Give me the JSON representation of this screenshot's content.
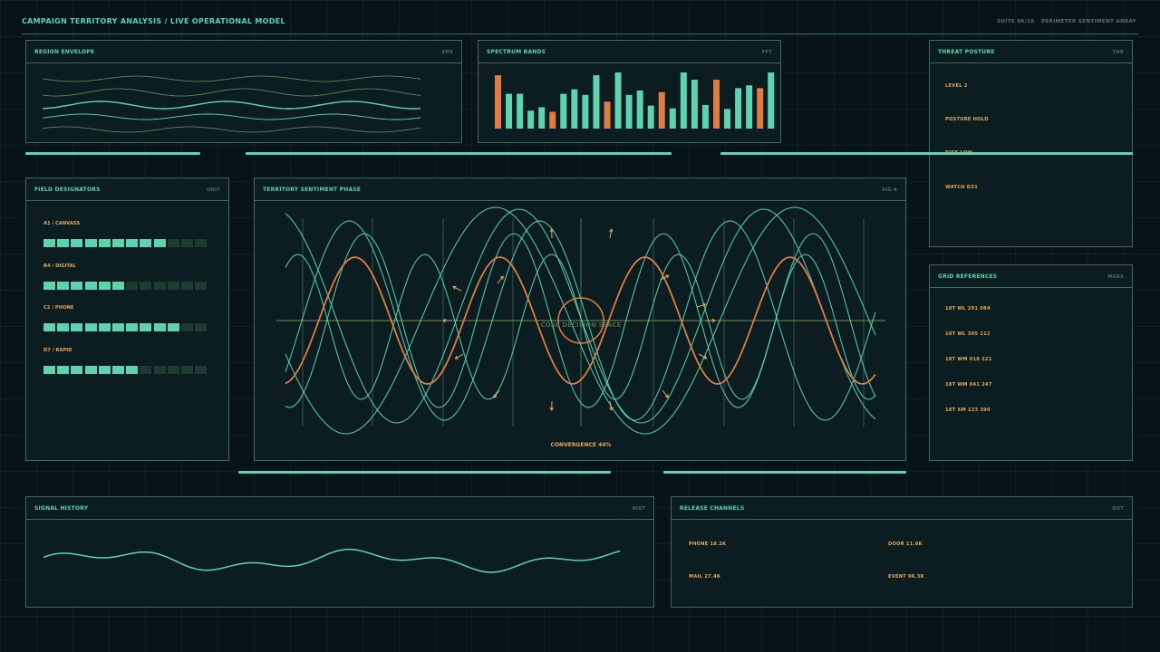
{
  "header": {
    "title": "CAMPAIGN TERRITORY ANALYSIS / LIVE OPERATIONAL MODEL",
    "suite": "SUITE 06/10",
    "array": "PERIMETER SENTIMENT ARRAY"
  },
  "colors": {
    "accent": "#5fd3b0",
    "warn": "#e7a65a",
    "orange": "#e07b45",
    "border": "#3f6c54"
  },
  "region_envelope": {
    "title": "REGION ENVELOPE",
    "code": "ENV"
  },
  "spectrum": {
    "title": "SPECTRUM BANDS",
    "code": "FFT",
    "bands": [
      0.95,
      0.62,
      0.62,
      0.32,
      0.38,
      0.3,
      0.62,
      0.7,
      0.6,
      0.95,
      0.48,
      1.0,
      0.6,
      0.68,
      0.41,
      0.65,
      0.36,
      1.0,
      0.87,
      0.42,
      0.87,
      0.35,
      0.72,
      0.77,
      0.72,
      1.0
    ],
    "highlight_bands": [
      0,
      5,
      10,
      15,
      20,
      24
    ]
  },
  "threat": {
    "title": "THREAT POSTURE",
    "code": "THR",
    "rows": [
      {
        "text": "LEVEL  2"
      },
      {
        "text": "POSTURE HOLD"
      },
      {
        "text": "RISK  LOW"
      },
      {
        "text": "WATCH  D31"
      }
    ]
  },
  "field": {
    "title": "FIELD DESIGNATORS",
    "code": "UNIT",
    "units": [
      {
        "label": "A1 / CANVASS",
        "filled": 9,
        "total": 12
      },
      {
        "label": "B4 / DIGITAL",
        "filled": 6,
        "total": 12
      },
      {
        "label": "C2 / PHONE",
        "filled": 10,
        "total": 12
      },
      {
        "label": "D7 / RAPID",
        "filled": 7,
        "total": 12
      }
    ]
  },
  "territory": {
    "title": "TERRITORY SENTIMENT PHASE",
    "code": "SIG-4",
    "center_label": "CORE DECISION SPACE",
    "convergence": "CONVERGENCE 44%"
  },
  "grid_refs": {
    "title": "GRID REFERENCES",
    "code": "MGRS",
    "items": [
      "18T WL 291 084",
      "18T WL 305 112",
      "18T WM 018 221",
      "18T WM 041 247",
      "18T XM 123 390"
    ]
  },
  "history": {
    "title": "SIGNAL HISTORY",
    "code": "HIST"
  },
  "release": {
    "title": "RELEASE CHANNELS",
    "code": "OUT",
    "channels": [
      {
        "label": "PHONE  18.2K"
      },
      {
        "label": "DOOR  11.8K"
      },
      {
        "label": "MAIL  27.4K"
      },
      {
        "label": "EVENT  06.3K"
      }
    ]
  }
}
